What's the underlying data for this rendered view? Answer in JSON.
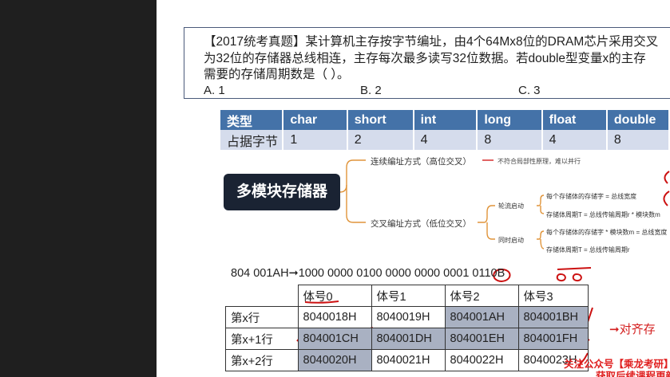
{
  "question": {
    "line1": "【2017统考真题】某计算机主存按字节编址，由4个64Mx8位的DRAM芯片采用交叉",
    "line2": "为32位的存储器总线相连，主存每次最多读写32位数据。若double型变量x的主存",
    "line3": "需要的存储周期数是（ ）。",
    "options": [
      "A. 1",
      "B. 2",
      "C. 3"
    ]
  },
  "type_table": {
    "header": [
      "类型",
      "char",
      "short",
      "int",
      "long",
      "float",
      "double"
    ],
    "row": [
      "占据字节",
      "1",
      "2",
      "4",
      "8",
      "4",
      "8"
    ]
  },
  "mindmap": {
    "root": "多模块存储器",
    "branch1": "连续编址方式（高位交叉）",
    "branch1_note": "不符合局部性原理，难以并行",
    "branch2": "交叉编址方式（低位交叉）",
    "sub1": "轮流启动",
    "sub1_item1": "每个存储体的存储字 = 总线宽度",
    "sub1_item2": "存储体周期T = 总线传输周期r * 模块数m",
    "sub2": "同时启动",
    "sub2_item1": "每个存储体的存储字 * 模块数m = 总线宽度",
    "sub2_item2": "存储体周期T = 总线传输周期r"
  },
  "address_line": "804 001AH➞1000 0000 0100 0000 0000 0001 0110B",
  "bank_table": {
    "header": [
      "",
      "体号0",
      "体号1",
      "体号2",
      "体号3"
    ],
    "rows": [
      [
        "第x行",
        "8040018H",
        "8040019H",
        "804001AH",
        "804001BH"
      ],
      [
        "第x+1行",
        "804001CH",
        "804001DH",
        "804001EH",
        "804001FH"
      ],
      [
        "第x+2行",
        "8040020H",
        "8040021H",
        "8040022H",
        "8040023H"
      ]
    ]
  },
  "annotation": "➞对齐存",
  "watermark": {
    "line1": "关注公众号【乘龙考研】",
    "line2": "获取后续课程更新"
  },
  "colors": {
    "table_header": "#4472a8",
    "table_row": "#d5dcec",
    "mindmap_root": "#1a2333",
    "connector": "#e0943a",
    "annotation": "#d42020"
  }
}
